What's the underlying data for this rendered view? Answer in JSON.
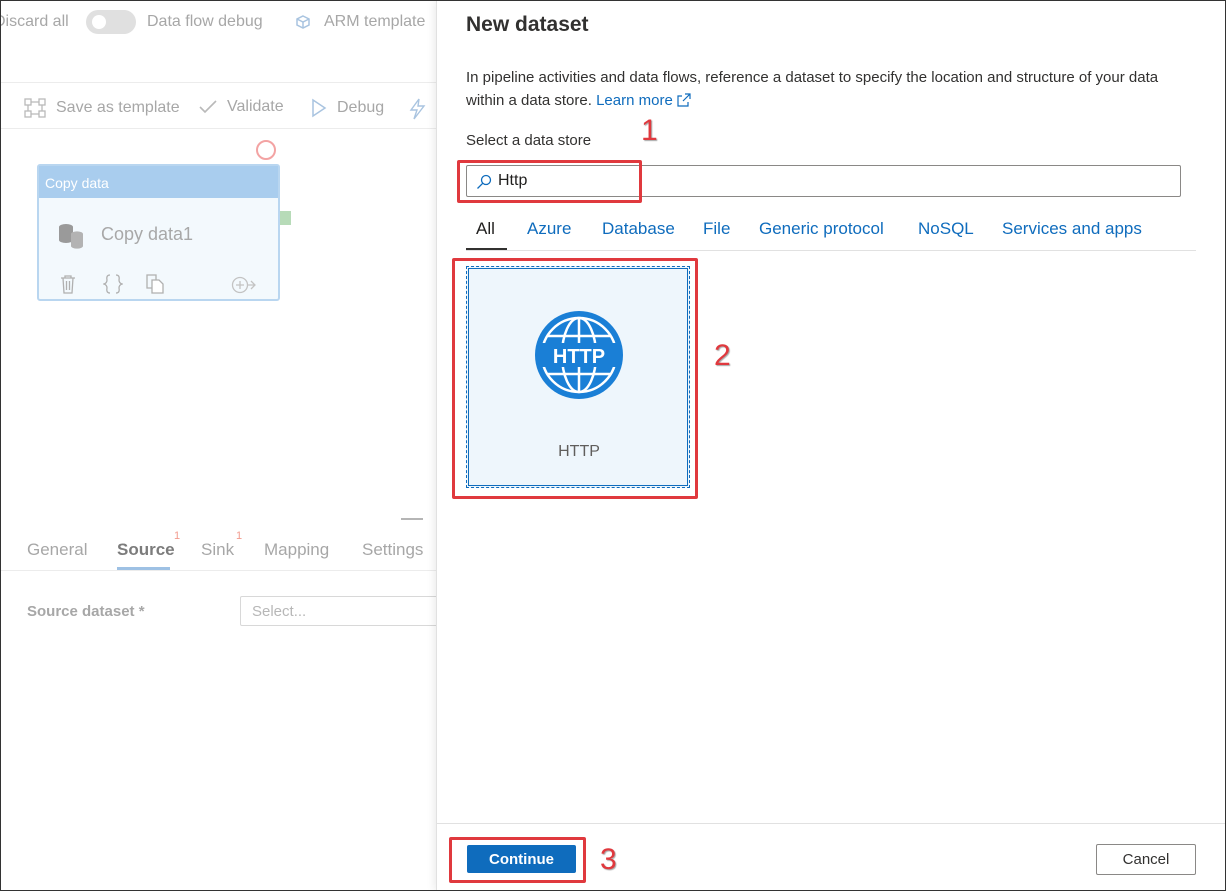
{
  "topbar": {
    "discard_label": "Discard all",
    "data_flow_debug_label": "Data flow debug",
    "arm_template_label": "ARM template"
  },
  "toolbar": {
    "save_as_template": "Save as template",
    "validate": "Validate",
    "debug": "Debug"
  },
  "activity": {
    "header": "Copy data",
    "name": "Copy data1"
  },
  "bottom_tabs": {
    "general": "General",
    "source": "Source",
    "source_badge": "1",
    "sink": "Sink",
    "sink_badge": "1",
    "mapping": "Mapping",
    "settings": "Settings"
  },
  "source_dataset": {
    "label": "Source dataset *",
    "placeholder": "Select..."
  },
  "panel": {
    "title": "New dataset",
    "description": "In pipeline activities and data flows, reference a dataset to specify the location and structure of your data within a data store.",
    "learn_more": "Learn more",
    "store_label": "Select a data store",
    "search_value": "Http",
    "tabs": [
      "All",
      "Azure",
      "Database",
      "File",
      "Generic protocol",
      "NoSQL",
      "Services and apps"
    ],
    "selected_tab": "All",
    "tile": {
      "icon_text": "HTTP",
      "label": "HTTP"
    },
    "continue_label": "Continue",
    "cancel_label": "Cancel"
  },
  "callouts": [
    "1",
    "2",
    "3"
  ],
  "colors": {
    "accent": "#0f6cbd",
    "callout": "#e0393e",
    "tile_bg": "#eef6fc"
  }
}
